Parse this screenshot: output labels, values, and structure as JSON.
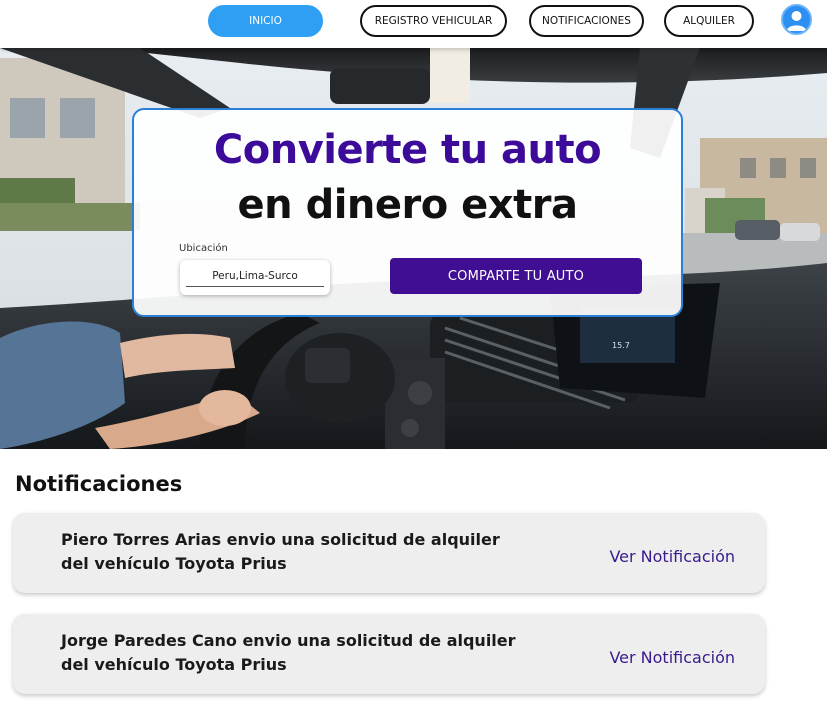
{
  "nav": {
    "items": [
      {
        "label": "INICIO",
        "active": true
      },
      {
        "label": "REGISTRO VEHICULAR",
        "active": false
      },
      {
        "label": "NOTIFICACIONES",
        "active": false
      },
      {
        "label": "ALQUILER",
        "active": false
      }
    ],
    "avatar_icon": "user-icon"
  },
  "hero": {
    "title_line1": "Convierte tu auto",
    "title_line2": "en dinero extra",
    "location_label": "Ubicación",
    "location_value": "Peru,Lima-Surco",
    "share_button_label": "COMPARTE TU AUTO",
    "background_image": "car-interior-photo"
  },
  "notifications": {
    "title": "Notificaciones",
    "items": [
      {
        "text": "Piero Torres Arias envio una solicitud de alquiler del vehículo Toyota Prius",
        "link": "Ver Notificación"
      },
      {
        "text": "Jorge Paredes Cano envio una solicitud de alquiler del vehículo Toyota Prius",
        "link": "Ver Notificación"
      }
    ]
  },
  "colors": {
    "primary_purple": "#3d0b9a",
    "nav_active_blue": "#2e9ff3",
    "card_border_blue": "#2a7fd6"
  }
}
